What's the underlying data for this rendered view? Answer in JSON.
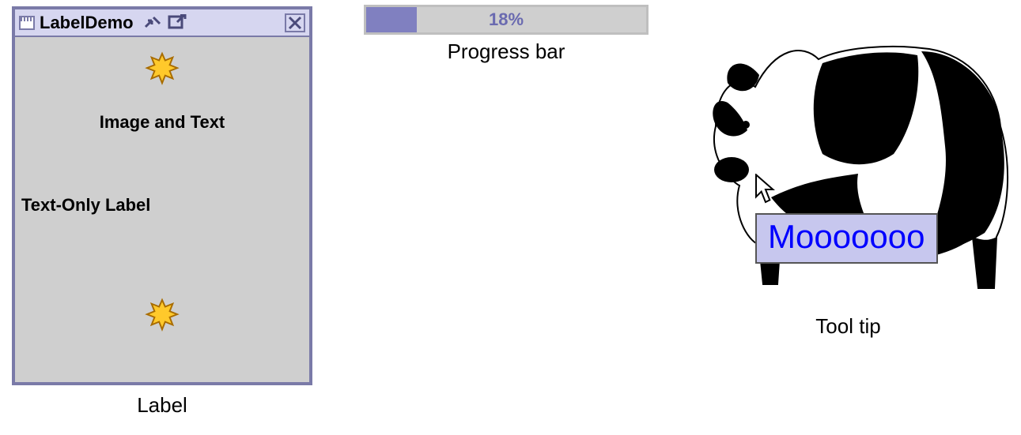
{
  "labelDemo": {
    "windowTitle": "LabelDemo",
    "imageAndText": "Image and Text",
    "textOnly": "Text-Only Label",
    "caption": "Label"
  },
  "progress": {
    "percent": 18,
    "text": "18%",
    "caption": "Progress bar"
  },
  "tooltip": {
    "text": "Mooooooo",
    "caption": "Tool tip"
  }
}
